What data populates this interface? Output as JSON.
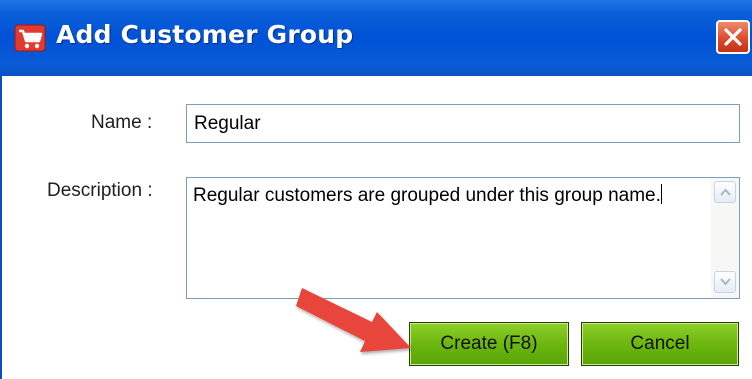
{
  "window": {
    "title": "Add Customer Group",
    "title_icon": "shopping-cart-icon",
    "close_icon": "close-icon"
  },
  "form": {
    "name_label": "Name :",
    "name_value": "Regular",
    "description_label": "Description :",
    "description_value": "Regular customers are grouped under this group name."
  },
  "buttons": {
    "create_label": "Create (F8)",
    "cancel_label": "Cancel"
  },
  "colors": {
    "titlebar": "#0052d6",
    "button_green": "#6cb70f",
    "close_red": "#d9482a",
    "annotation_arrow": "#e8453c"
  }
}
